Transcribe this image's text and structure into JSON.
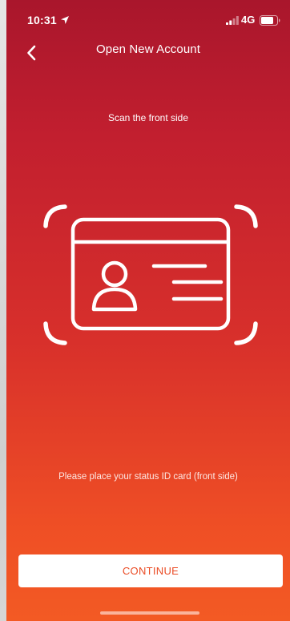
{
  "status_bar": {
    "time": "10:31",
    "network": "4G",
    "icons": [
      "location-arrow-icon",
      "signal-icon",
      "battery-icon"
    ]
  },
  "nav": {
    "title": "Open New Account",
    "back_icon": "chevron-left-icon"
  },
  "scan": {
    "title": "Scan the front side",
    "illustration_icon": "id-card-scan-icon",
    "instruction": "Please place your status ID card (front side)"
  },
  "actions": {
    "continue_label": "CONTINUE"
  },
  "colors": {
    "gradient_top": "#a9162c",
    "gradient_bottom": "#f35a24",
    "button_text": "#ea4b24",
    "button_background": "#ffffff"
  }
}
